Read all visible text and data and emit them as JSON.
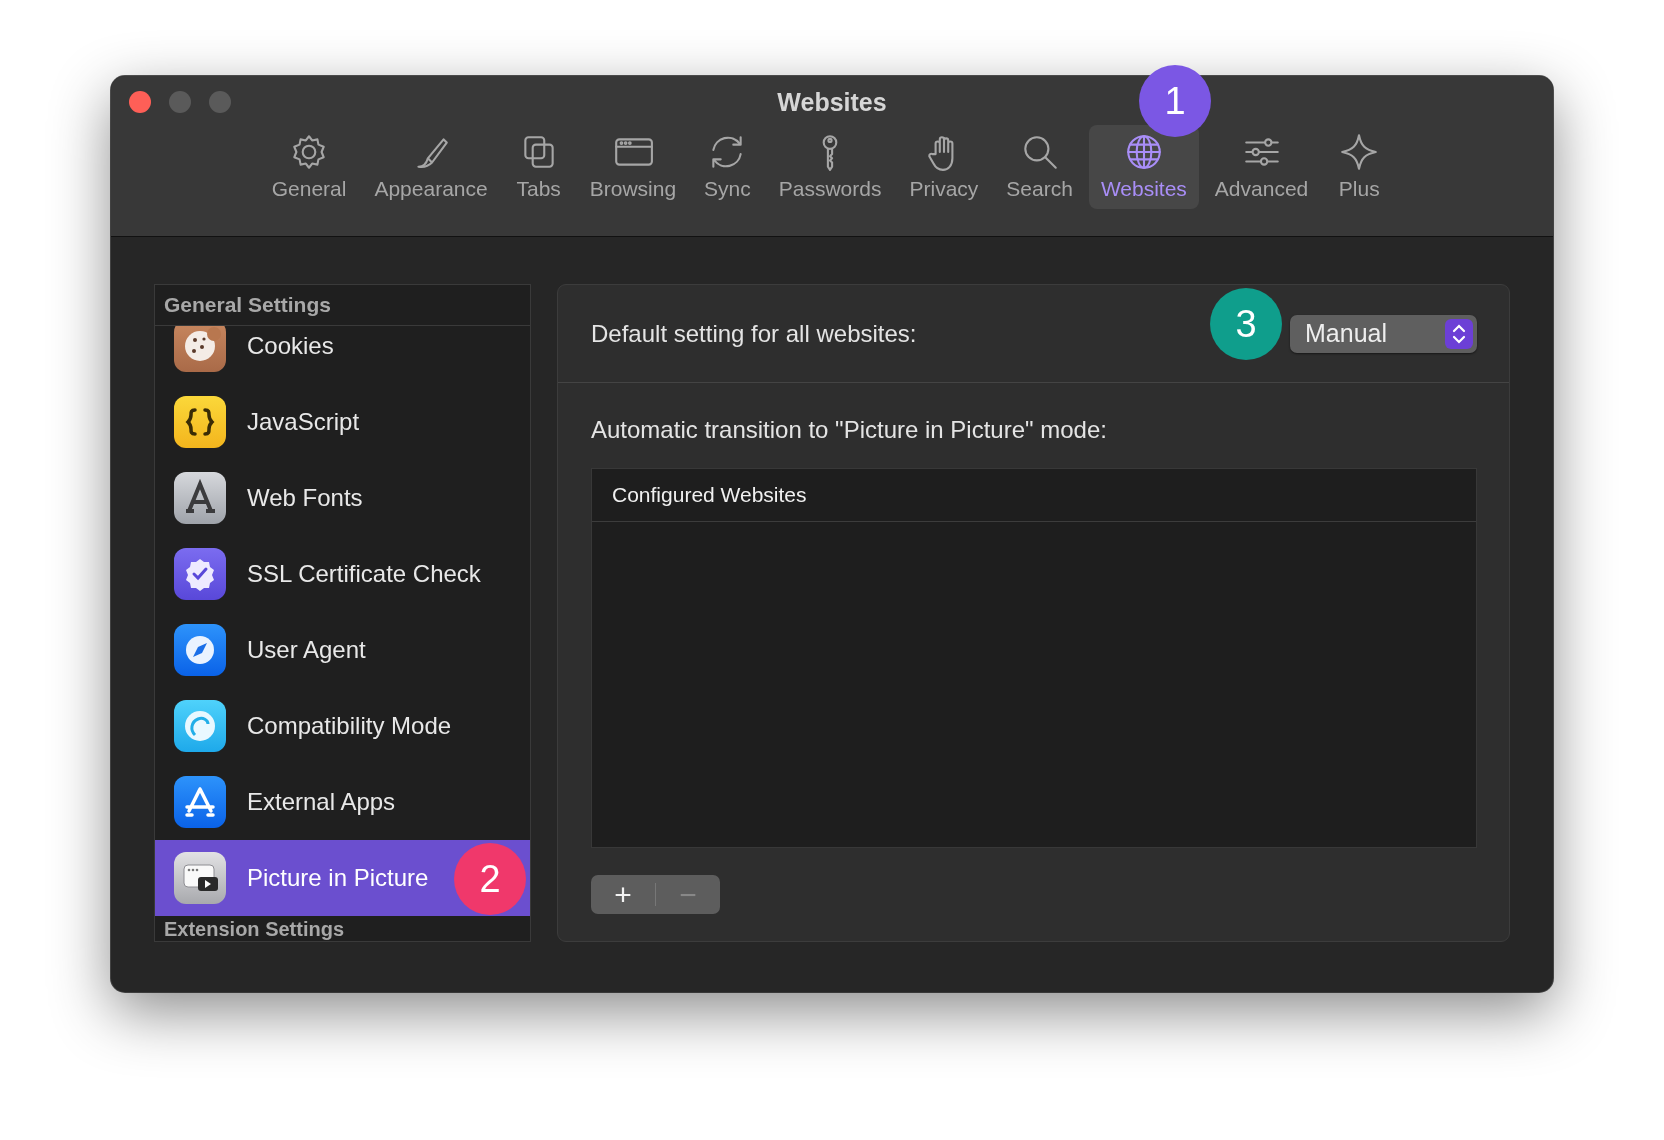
{
  "window": {
    "title": "Websites"
  },
  "toolbar": [
    {
      "label": "General",
      "selected": false
    },
    {
      "label": "Appearance",
      "selected": false
    },
    {
      "label": "Tabs",
      "selected": false
    },
    {
      "label": "Browsing",
      "selected": false
    },
    {
      "label": "Sync",
      "selected": false
    },
    {
      "label": "Passwords",
      "selected": false
    },
    {
      "label": "Privacy",
      "selected": false
    },
    {
      "label": "Search",
      "selected": false
    },
    {
      "label": "Websites",
      "selected": true
    },
    {
      "label": "Advanced",
      "selected": false
    },
    {
      "label": "Plus",
      "selected": false
    }
  ],
  "sidebar": {
    "header": "General Settings",
    "items": [
      {
        "label": "Cookies",
        "selected": false
      },
      {
        "label": "JavaScript",
        "selected": false
      },
      {
        "label": "Web Fonts",
        "selected": false
      },
      {
        "label": "SSL Certificate Check",
        "selected": false
      },
      {
        "label": "User Agent",
        "selected": false
      },
      {
        "label": "Compatibility Mode",
        "selected": false
      },
      {
        "label": "External Apps",
        "selected": false
      },
      {
        "label": "Picture in Picture",
        "selected": true
      }
    ],
    "next_header": "Extension Settings"
  },
  "panel": {
    "default_label": "Default setting for all websites:",
    "default_value": "Manual",
    "transition_label": "Automatic transition to \"Picture in Picture\" mode:",
    "table": {
      "columns": [
        "Configured Websites"
      ]
    },
    "buttons": [
      {
        "label": "+",
        "disabled": false
      },
      {
        "label": "−",
        "disabled": true
      }
    ]
  },
  "annotations": [
    {
      "text": "1",
      "color": "#7b57e4"
    },
    {
      "text": "2",
      "color": "#f0386b"
    },
    {
      "text": "3",
      "color": "#0f9e8c"
    }
  ]
}
